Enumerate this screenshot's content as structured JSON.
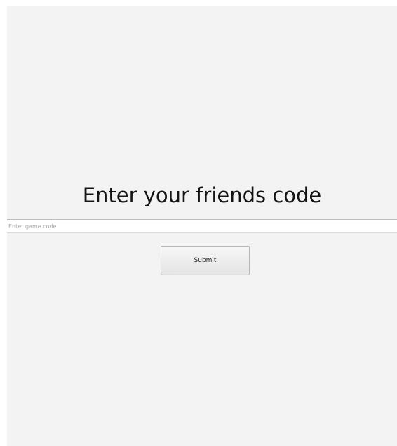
{
  "main": {
    "heading": "Enter your friends code",
    "code_input": {
      "placeholder": "Enter game code",
      "value": ""
    },
    "submit_label": "Submit"
  }
}
